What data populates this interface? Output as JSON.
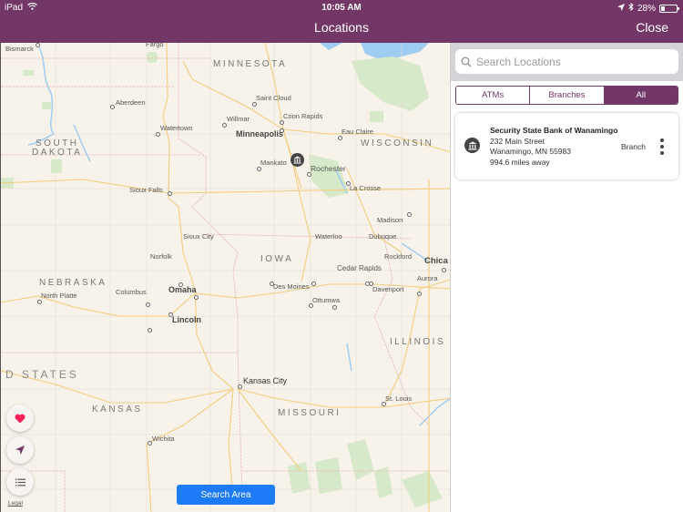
{
  "status_bar": {
    "device": "iPad",
    "time": "10:05 AM",
    "battery_percent": "28%",
    "battery_level": 0.28
  },
  "nav": {
    "title": "Locations",
    "close_label": "Close"
  },
  "map": {
    "cities": [
      {
        "name": "Bismarck"
      },
      {
        "name": "Fargo"
      },
      {
        "name": "Aberdeen"
      },
      {
        "name": "Watertown"
      },
      {
        "name": "Saint Cloud"
      },
      {
        "name": "Willmar"
      },
      {
        "name": "Coon Rapids"
      },
      {
        "name": "Minneapolis"
      },
      {
        "name": "Eau Claire"
      },
      {
        "name": "Mankato"
      },
      {
        "name": "Rochester"
      },
      {
        "name": "La Crosse"
      },
      {
        "name": "Sioux Falls"
      },
      {
        "name": "Madison"
      },
      {
        "name": "Sioux City"
      },
      {
        "name": "Waterloo"
      },
      {
        "name": "Dubuque"
      },
      {
        "name": "Rockford"
      },
      {
        "name": "Norfolk"
      },
      {
        "name": "Chica"
      },
      {
        "name": "Cedar Rapids"
      },
      {
        "name": "Aurora"
      },
      {
        "name": "Columbus"
      },
      {
        "name": "Omaha"
      },
      {
        "name": "North Platte"
      },
      {
        "name": "Des Moines"
      },
      {
        "name": "Davenport"
      },
      {
        "name": "Ottumwa"
      },
      {
        "name": "Lincoln"
      },
      {
        "name": "Kansas City"
      },
      {
        "name": "St. Louis"
      },
      {
        "name": "Wichita"
      }
    ],
    "regions": {
      "minnesota": "MINNESOTA",
      "south": "SOUTH",
      "dakota": "DAKOTA",
      "wisconsin": "WISCONSIN",
      "iowa": "IOWA",
      "nebraska": "NEBRASKA",
      "illinois": "ILLINOIS",
      "united_states": "D STATES",
      "kansas": "KANSAS",
      "missouri": "MISSOURI"
    },
    "legal_label": "Legal",
    "search_area_label": "Search Area",
    "favorites_color": "#ff1f5a"
  },
  "panel": {
    "search_placeholder": "Search Locations",
    "search_value": "",
    "filters": [
      {
        "label": "ATMs",
        "active": false
      },
      {
        "label": "Branches",
        "active": false
      },
      {
        "label": "All",
        "active": true
      }
    ],
    "results": [
      {
        "name": "Security State Bank of Wanamingo",
        "street": "232 Main Street",
        "city_line": "Wanamingo, MN 55983",
        "distance": "994.6 miles away",
        "type": "Branch"
      }
    ]
  },
  "colors": {
    "brand": "#723766",
    "button_blue": "#1d7bf7"
  }
}
